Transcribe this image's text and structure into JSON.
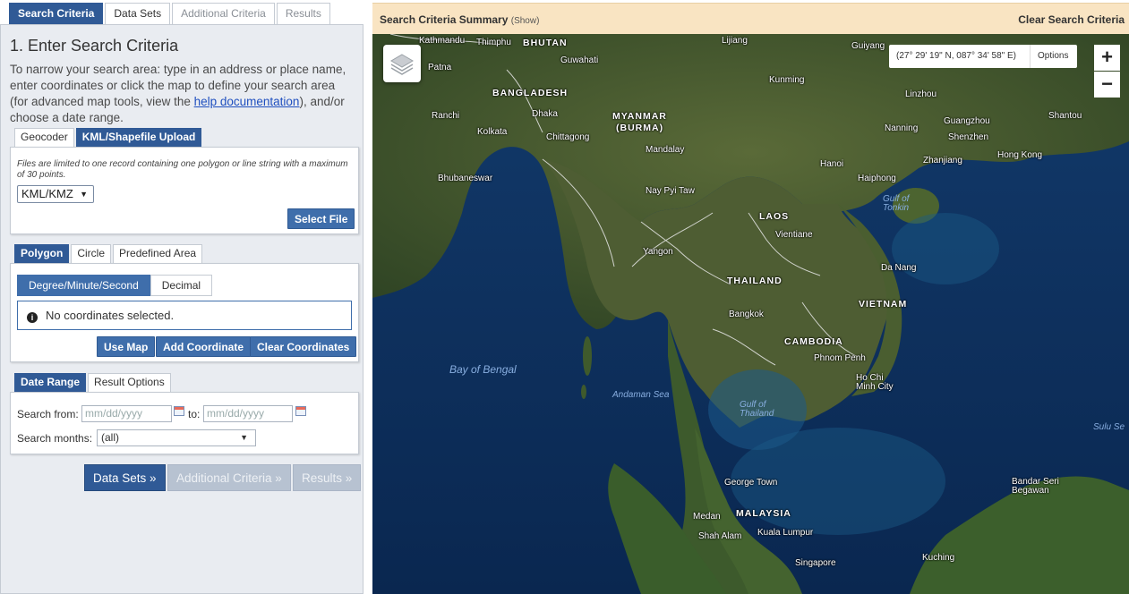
{
  "top_tabs": [
    {
      "label": "Search Criteria"
    },
    {
      "label": "Data Sets"
    },
    {
      "label": "Additional Criteria"
    },
    {
      "label": "Results"
    }
  ],
  "heading": "1. Enter Search Criteria",
  "intro": {
    "before": "To narrow your search area: type in an address or place name, enter coordinates or click the map to define your search area (for advanced map tools, view the ",
    "link": "help documentation",
    "after": "), and/or choose a date range."
  },
  "geo_tabs": {
    "geocoder": "Geocoder",
    "upload": "KML/Shapefile Upload"
  },
  "upload": {
    "note": "Files are limited to one record containing one polygon or line string with a maximum of 30 points.",
    "file_type": "KML/KMZ",
    "select_file": "Select File"
  },
  "area_tabs": {
    "polygon": "Polygon",
    "circle": "Circle",
    "predefined": "Predefined Area"
  },
  "coords": {
    "format_dms": "Degree/Minute/Second",
    "format_decimal": "Decimal",
    "message": "No coordinates selected.",
    "use_map": "Use Map",
    "add": "Add Coordinate",
    "clear": "Clear Coordinates"
  },
  "date_tabs": {
    "range": "Date Range",
    "options": "Result Options"
  },
  "date": {
    "from_label": "Search from:",
    "to_label": "to:",
    "placeholder": "mm/dd/yyyy",
    "months_label": "Search months:",
    "months_value": "(all)"
  },
  "nav": {
    "data_sets": "Data Sets »",
    "additional": "Additional Criteria »",
    "results": "Results »"
  },
  "summary": {
    "title": "Search Criteria Summary",
    "show": "(Show)",
    "clear": "Clear Search Criteria"
  },
  "map": {
    "coordinate": "(27° 29' 19\" N, 087° 34' 58\" E)",
    "options": "Options",
    "zoom_in": "+",
    "zoom_out": "−",
    "labels": {
      "kathmandu": "Kathmandu",
      "thimphu": "Thimphu",
      "bhutan": "BHUTAN",
      "lijiang": "Lijiang",
      "guiyang": "Guiyang",
      "patna": "Patna",
      "guwahati": "Guwahati",
      "kunming": "Kunming",
      "bangladesh": "BANGLADESH",
      "linzhou": "Linzhou",
      "ranchi": "Ranchi",
      "dhaka": "Dhaka",
      "kolkata": "Kolkata",
      "chittagong": "Chittagong",
      "myanmar": "MYANMAR",
      "burma": "(BURMA)",
      "nanning": "Nanning",
      "guangzhou": "Guangzhou",
      "shenzhen": "Shenzhen",
      "shantou": "Shantou",
      "hongkong": "Hong Kong",
      "mandalay": "Mandalay",
      "hanoi": "Hanoi",
      "haiphong": "Haiphong",
      "zhanjiang": "Zhanjiang",
      "bhubaneswar": "Bhubaneswar",
      "naypyitaw": "Nay Pyi Taw",
      "tonkin": "Gulf of\nTonkin",
      "laos": "LAOS",
      "vientiane": "Vientiane",
      "yangon": "Yangon",
      "danang": "Da Nang",
      "thailand": "THAILAND",
      "vietnam": "VIETNAM",
      "bangkok": "Bangkok",
      "cambodia": "CAMBODIA",
      "phnompenh": "Phnom Penh",
      "hochiminh": "Ho Chi\nMinh City",
      "bengal": "Bay of Bengal",
      "andaman": "Andaman Sea",
      "gulfthailand": "Gulf of\nThailand",
      "sulu": "Sulu Se",
      "georgetown": "George Town",
      "bandarseri": "Bandar Seri\nBegawan",
      "medan": "Medan",
      "malaysia": "MALAYSIA",
      "shahalam": "Shah Alam",
      "kualalumpur": "Kuala Lumpur",
      "singapore": "Singapore",
      "kuching": "Kuching"
    }
  }
}
